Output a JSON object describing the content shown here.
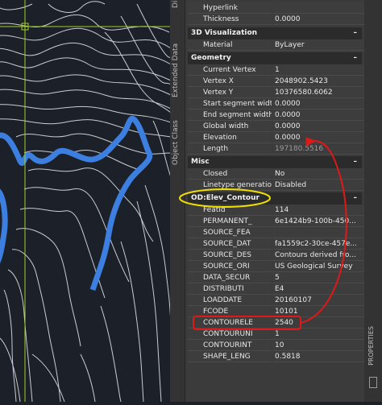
{
  "side_tabs": {
    "top": "Di",
    "extended_data": "Extended Data",
    "object_class": "Object Class"
  },
  "sections": {
    "visualization": "3D Visualization",
    "geometry": "Geometry",
    "misc": "Misc",
    "od": "OD:Elev_Contour",
    "toggle": "–"
  },
  "rows": {
    "hyperlink": {
      "label": "Hyperlink",
      "value": ""
    },
    "thickness": {
      "label": "Thickness",
      "value": "0.0000"
    },
    "material": {
      "label": "Material",
      "value": "ByLayer"
    },
    "current_vertex": {
      "label": "Current Vertex",
      "value": "1"
    },
    "vertex_x": {
      "label": "Vertex X",
      "value": "2048902.5423"
    },
    "vertex_y": {
      "label": "Vertex Y",
      "value": "10376580.6062"
    },
    "start_seg": {
      "label": "Start segment width",
      "value": "0.0000"
    },
    "end_seg": {
      "label": "End segment width",
      "value": "0.0000"
    },
    "global_width": {
      "label": "Global width",
      "value": "0.0000"
    },
    "elevation": {
      "label": "Elevation",
      "value": "0.0000"
    },
    "length": {
      "label": "Length",
      "value": "197180.5516"
    },
    "closed": {
      "label": "Closed",
      "value": "No"
    },
    "linetype_gen": {
      "label": "Linetype generation",
      "value": "Disabled"
    },
    "featid": {
      "label": "FeatId",
      "value": "114"
    },
    "permanent": {
      "label": "PERMANENT_",
      "value": "6e1424b9-100b-450..."
    },
    "source_fea": {
      "label": "SOURCE_FEA",
      "value": ""
    },
    "source_dat": {
      "label": "SOURCE_DAT",
      "value": "fa1559c2-30ce-457e..."
    },
    "source_des": {
      "label": "SOURCE_DES",
      "value": "Contours derived fro..."
    },
    "source_ori": {
      "label": "SOURCE_ORI",
      "value": "US Geological Survey"
    },
    "data_secur": {
      "label": "DATA_SECUR",
      "value": "5"
    },
    "distributi": {
      "label": "DISTRIBUTI",
      "value": "E4"
    },
    "loaddate": {
      "label": "LOADDATE",
      "value": "20160107"
    },
    "fcode": {
      "label": "FCODE",
      "value": "10101"
    },
    "contourele": {
      "label": "CONTOURELE",
      "value": "2540"
    },
    "contouruni": {
      "label": "CONTOURUNI",
      "value": "1"
    },
    "contourint": {
      "label": "CONTOURINT",
      "value": "10"
    },
    "shape_leng": {
      "label": "SHAPE_LENG",
      "value": "0.5818"
    }
  },
  "properties_tab": "PROPERTIES",
  "colors": {
    "highlight_contour": "#3d7fe0",
    "annotation_red": "#e01818",
    "annotation_yellow": "#f0e000",
    "crosshair": "#9fcf1f"
  }
}
